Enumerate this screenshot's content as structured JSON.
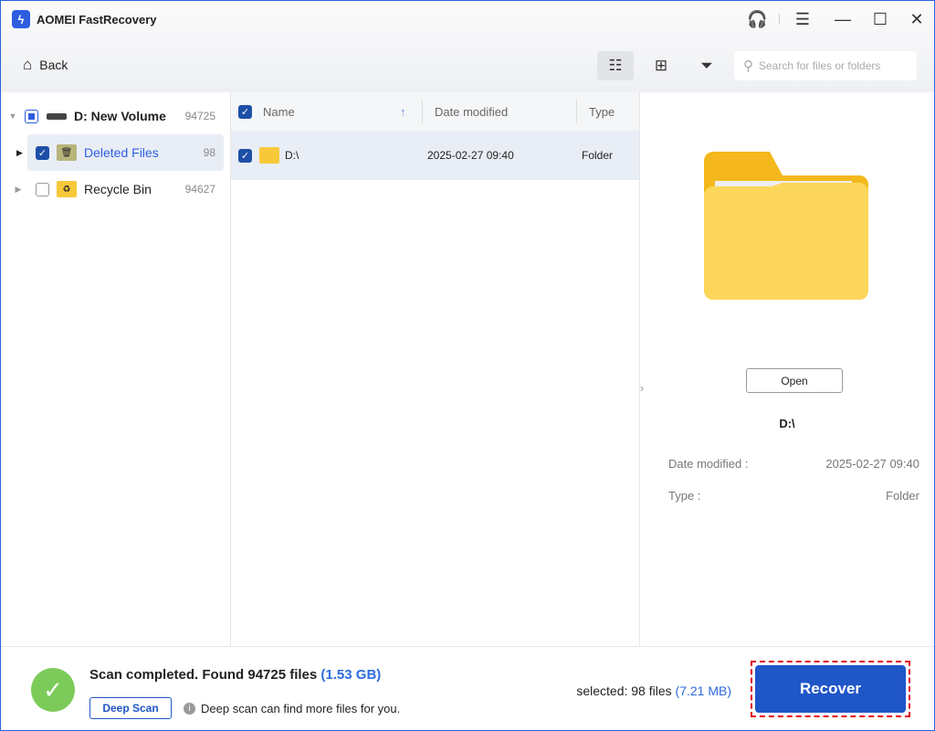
{
  "app": {
    "title": "AOMEI FastRecovery"
  },
  "toolbar": {
    "back": "Back",
    "search_placeholder": "Search for files or folders"
  },
  "tree": [
    {
      "label": "D: New Volume",
      "count": "94725"
    },
    {
      "label": "Deleted Files",
      "count": "98"
    },
    {
      "label": "Recycle Bin",
      "count": "94627"
    }
  ],
  "list": {
    "columns": [
      "Name",
      "Date modified",
      "Type"
    ],
    "rows": [
      {
        "name": "D:\\",
        "date": "2025-02-27 09:40",
        "type": "Folder"
      }
    ]
  },
  "preview": {
    "open": "Open",
    "name": "D:\\",
    "date_label": "Date modified :",
    "date": "2025-02-27 09:40",
    "type_label": "Type :",
    "type": "Folder"
  },
  "footer": {
    "status": "Scan completed. Found 94725 files",
    "size": "(1.53 GB)",
    "deep_scan": "Deep Scan",
    "hint": "Deep scan can find more files for you.",
    "selected": "selected: 98 files",
    "selected_size": "(7.21 MB)",
    "recover": "Recover"
  },
  "colors": {
    "accent": "#1f56c8",
    "link": "#2d6be0"
  }
}
